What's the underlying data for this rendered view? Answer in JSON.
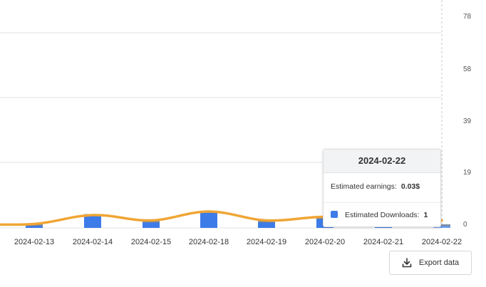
{
  "chart_data": {
    "type": "bar",
    "categories": [
      "",
      "2024-02-13",
      "2024-02-14",
      "2024-02-15",
      "2024-02-18",
      "2024-02-19",
      "2024-02-20",
      "2024-02-21",
      "2024-02-22"
    ],
    "y_ticks": [
      "78",
      "58",
      "39",
      "19",
      "0"
    ],
    "ylim": [
      0,
      78
    ],
    "series": [
      {
        "name": "Estimated Downloads",
        "kind": "bar",
        "color": "#3d7be8",
        "values": [
          0,
          1,
          4,
          2,
          5,
          2,
          3,
          1,
          1
        ]
      },
      {
        "name": "Estimated earnings",
        "kind": "line",
        "color": "#f0a534",
        "values": [
          0.01,
          0.01,
          0.06,
          0.03,
          0.08,
          0.03,
          0.05,
          0.03,
          0.03
        ]
      }
    ],
    "tooltip": {
      "title": "2024-02-22",
      "earnings_label": "Estimated earnings:",
      "earnings_value": "0.03$",
      "downloads_label": "Estimated Downloads:",
      "downloads_value": "1"
    },
    "grid": true
  },
  "export": {
    "label": "Export data",
    "icon": "download-icon"
  }
}
